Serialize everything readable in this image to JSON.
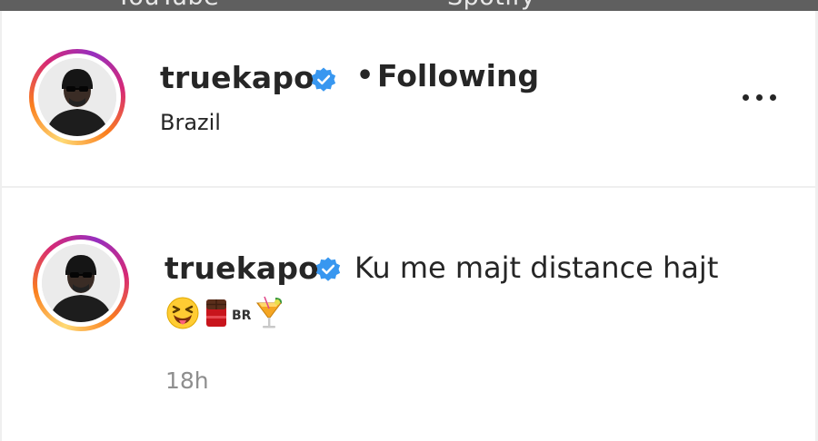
{
  "top_nav": {
    "item_1": "YouTube",
    "item_2": "Spotify"
  },
  "post_header": {
    "username": "truekapo",
    "verified_icon": "verified-badge-icon",
    "separator": "•",
    "follow_status": "Following",
    "location": "Brazil",
    "more_icon": "more-options-icon"
  },
  "caption": {
    "username": "truekapo",
    "text": "Ku me majt distance hajt",
    "emoji_line": {
      "emoji_1": "squinting-face-with-tongue-emoji",
      "emoji_2": "chocolate-bar-emoji",
      "br_text": "BR",
      "emoji_3": "tropical-drink-emoji"
    },
    "timestamp": "18h"
  },
  "colors": {
    "verified": "#3897f0",
    "text_primary": "#262626",
    "text_secondary": "#8e8e8e",
    "divider": "#efefef"
  }
}
